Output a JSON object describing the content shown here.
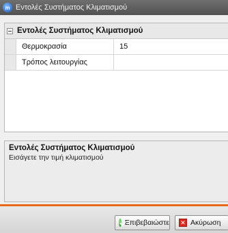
{
  "window": {
    "title": "Εντολές Συστήματος Κλιματισμού"
  },
  "grid": {
    "category_label": "Εντολές Συστήματος Κλιματισμού",
    "properties": [
      {
        "name": "Θερμοκρασία",
        "value": "15"
      },
      {
        "name": "Τρόπος λειτουργίας",
        "value": ""
      }
    ]
  },
  "description": {
    "title": "Εντολές Συστήματος Κλιματισμού",
    "text": "Εισάγετε την τιμή κλιματισμού"
  },
  "buttons": {
    "ok_label": "Επιβεβαιώστε",
    "cancel_label": "Ακύρωση"
  },
  "colors": {
    "accent_line": "#e7681b",
    "titlebar": "#5f5f5f"
  }
}
